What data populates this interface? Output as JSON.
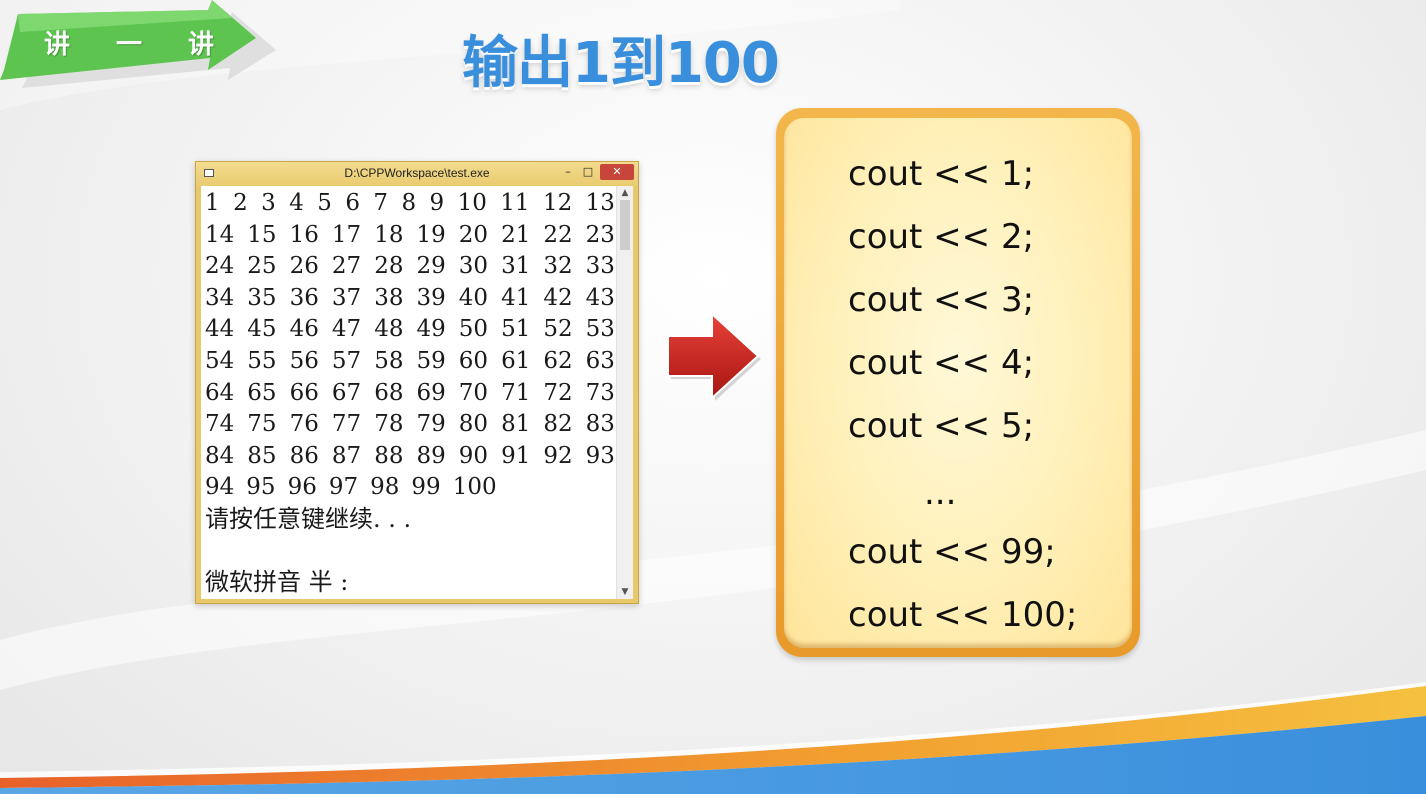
{
  "header": {
    "badge_chars": [
      "讲",
      "一",
      "讲"
    ],
    "title": "输出1到100"
  },
  "console": {
    "title": "D:\\CPPWorkspace\\test.exe",
    "buttons": {
      "minimize": "–",
      "maximize": "□",
      "close": "✕"
    },
    "number_rows": [
      [
        "1",
        "2",
        "3",
        "4",
        "5",
        "6",
        "7",
        "8",
        "9",
        "10",
        "11",
        "12",
        "13"
      ],
      [
        "14",
        "15",
        "16",
        "17",
        "18",
        "19",
        "20",
        "21",
        "22",
        "23"
      ],
      [
        "24",
        "25",
        "26",
        "27",
        "28",
        "29",
        "30",
        "31",
        "32",
        "33"
      ],
      [
        "34",
        "35",
        "36",
        "37",
        "38",
        "39",
        "40",
        "41",
        "42",
        "43"
      ],
      [
        "44",
        "45",
        "46",
        "47",
        "48",
        "49",
        "50",
        "51",
        "52",
        "53"
      ],
      [
        "54",
        "55",
        "56",
        "57",
        "58",
        "59",
        "60",
        "61",
        "62",
        "63"
      ],
      [
        "64",
        "65",
        "66",
        "67",
        "68",
        "69",
        "70",
        "71",
        "72",
        "73"
      ],
      [
        "74",
        "75",
        "76",
        "77",
        "78",
        "79",
        "80",
        "81",
        "82",
        "83"
      ],
      [
        "84",
        "85",
        "86",
        "87",
        "88",
        "89",
        "90",
        "91",
        "92",
        "93"
      ],
      [
        "94",
        "95",
        "96",
        "97",
        "98",
        "99",
        "100"
      ]
    ],
    "prompt": "请按任意键继续. . .",
    "ime_status": "微软拼音 半 :",
    "scroll_up": "▲",
    "scroll_down": "▼"
  },
  "code": {
    "lines": [
      "cout << 1;",
      "cout << 2;",
      "cout << 3;",
      "cout << 4;",
      "cout << 5;"
    ],
    "ellipsis": "...",
    "tail_lines": [
      "cout << 99;",
      "cout << 100;"
    ]
  },
  "colors": {
    "title_blue": "#3a8fdc",
    "badge_green": "#5cc44f",
    "arrow_red": "#c8201c",
    "card_orange": "#e89a2a",
    "card_fill": "#fff0b8"
  }
}
